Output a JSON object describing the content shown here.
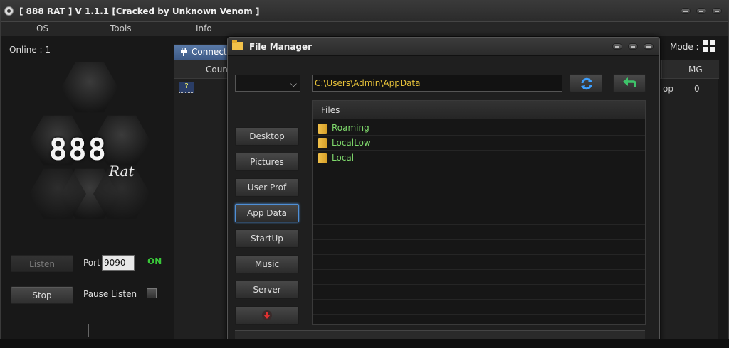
{
  "window": {
    "title": "[ 888 RAT ] V 1.1.1 [Cracked by Unknown Venom ]",
    "menu": [
      "OS",
      "Tools",
      "Info"
    ]
  },
  "status": {
    "online_label": "Online : 1",
    "mode_label": "Mode :"
  },
  "logo": {
    "text": "888",
    "subtext": "Rat"
  },
  "server_controls": {
    "listen_label": "Listen",
    "port_label": "Port",
    "port_value": "9090",
    "status": "ON",
    "status_color": "#39c839",
    "stop_label": "Stop",
    "pause_label": "Pause Listen",
    "pause_checked": false
  },
  "connections": {
    "tab_label": "Connecti",
    "columns": [
      "Coun",
      "MG"
    ],
    "row": {
      "flag": "?",
      "country": "-",
      "partial": "op",
      "mg": "0"
    }
  },
  "file_manager": {
    "title": "File Manager",
    "path": "C:\\Users\\Admin\\AppData",
    "path_color": "#e8c33a",
    "nav": [
      {
        "label": "Desktop",
        "active": false
      },
      {
        "label": "Pictures",
        "active": false
      },
      {
        "label": "User Prof",
        "active": false
      },
      {
        "label": "App Data",
        "active": true
      },
      {
        "label": "StartUp",
        "active": false
      },
      {
        "label": "Music",
        "active": false
      },
      {
        "label": "Server",
        "active": false
      }
    ],
    "download_icon": "download-arrow-icon",
    "refresh_icon": "refresh-icon",
    "back_icon": "back-arrow-icon",
    "files_header": "Files",
    "files": [
      "Roaming",
      "LocalLow",
      "Local"
    ],
    "file_color": "#7fd96c"
  }
}
